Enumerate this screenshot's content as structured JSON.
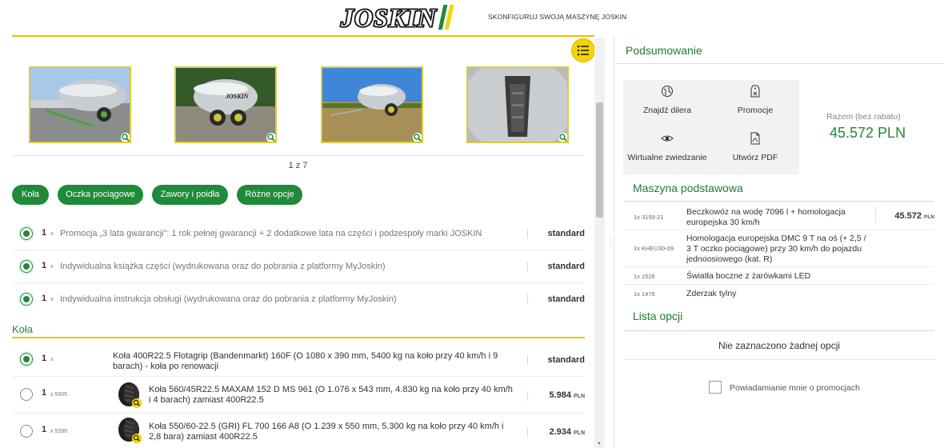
{
  "header": {
    "brand": "JOSKIN",
    "tagline": "SKONFIGURUJ SWOJĄ MASZYNĘ JOSKIN"
  },
  "gallery": {
    "pager": "1 z 7",
    "images": [
      "tanker-rear-view",
      "tanker-side-view",
      "tanker-field-view",
      "tanker-interior-view"
    ]
  },
  "chips": [
    "Koła",
    "Oczka pociągowe",
    "Zawory i poidła",
    "Różne opcje"
  ],
  "general_rows": [
    {
      "qty": "1",
      "x": "x",
      "desc": "Promocja „3 lata gwarancji”: 1 rok pełnej gwarancji + 2 dodatkowe lata na części i podzespoły marki JOSKIN",
      "price": "standard"
    },
    {
      "qty": "1",
      "x": "x",
      "desc": "Indywidualna książka części (wydrukowana oraz do pobrania z platformy MyJoskin)",
      "price": "standard"
    },
    {
      "qty": "1",
      "x": "x",
      "desc": "Indywidualna instrukcja obsługi (wydrukowana oraz do pobrania z platformy MyJoskin)",
      "price": "standard"
    }
  ],
  "wheels": {
    "title": "Koła",
    "rows": [
      {
        "qty": "1",
        "x": "x",
        "code": "",
        "desc": "Koła 400R22.5 Flotagrip (Bandenmarkt) 160F (O 1080 x 390 mm, 5400 kg na koło przy 40 km/h i 9 barach) - koła po renowacji",
        "price": "standard",
        "currency": ""
      },
      {
        "qty": "1",
        "x": "x",
        "code": "5605",
        "desc": "Koła 560/45R22.5 MAXAM 152 D MS 961 (O 1.076 x 543 mm, 4.830 kg na koło przy 40 km/h i 4 barach) zamiast 400R22.5",
        "price": "5.984",
        "currency": "PLN"
      },
      {
        "qty": "1",
        "x": "x",
        "code": "5596",
        "desc": "Koła 550/60-22.5 (GRI) FL 700 166 A8 (O 1.239 x 550 mm, 5.300 kg na koło przy 40 km/h i 2,8 bara) zamiast 400R22.5",
        "price": "2.934",
        "currency": "PLN"
      }
    ]
  },
  "summary": {
    "title": "Podsumowanie",
    "actions": {
      "dealer": "Znajdź dilera",
      "promo": "Promocje",
      "tour": "Wirtualne zwiedzanie",
      "pdf": "Utwórz PDF"
    },
    "total_label": "Razem (bez rabatu)",
    "total_value": "45.572 PLN"
  },
  "base_machine": {
    "title": "Maszyna podstawowa",
    "rows": [
      {
        "code": "1x 3159-21",
        "desc": "Beczkowóz na wodę 7096 l + homologacja europejska 30 km/h",
        "price": "45.572",
        "currency": "PLN"
      },
      {
        "code": "1x KHEU30-09",
        "desc": "Homologacja europejska DMC 9 T na oś (+ 2,5 / 3 T oczko pociągowe) przy 30 km/h do pojazdu jednoosiowego (kat. R)",
        "price": "",
        "currency": ""
      },
      {
        "code": "1x 1526",
        "desc": "Światła boczne z żarówkami LED",
        "price": "",
        "currency": ""
      },
      {
        "code": "1x 1476",
        "desc": "Zderzak tylny",
        "price": "",
        "currency": ""
      }
    ]
  },
  "options": {
    "title": "Lista opcji",
    "empty": "Nie zaznaczono żadnej opcji",
    "notify_label": "Powiadamianie mnie o promocjach"
  },
  "colors": {
    "brand_green": "#1f8a38",
    "accent_yellow": "#f5d400"
  }
}
